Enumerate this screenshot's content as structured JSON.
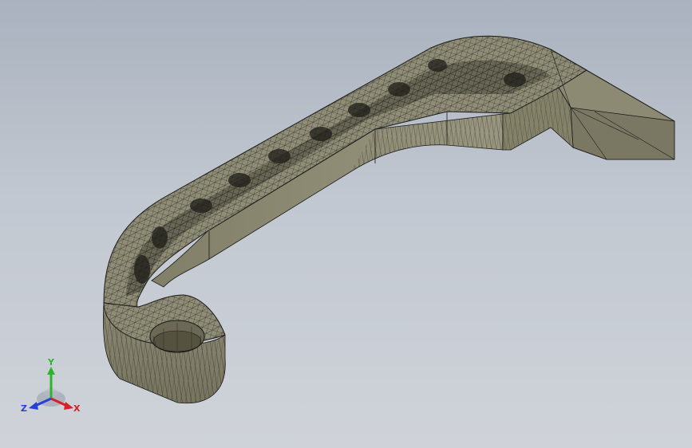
{
  "viewport": {
    "background_top": "#a9b2be",
    "background_bottom": "#cfd3d9"
  },
  "model": {
    "shape": "hook-bracket",
    "render_mode": "shaded-with-tessellation-edges",
    "face_color": "#8f8d76",
    "face_dark": "#6e6c59",
    "face_light": "#a09e88",
    "edge_color": "#1a1a1a"
  },
  "triad": {
    "x_label": "X",
    "y_label": "Y",
    "z_label": "Z",
    "x_color": "#d81f26",
    "y_color": "#2db32d",
    "z_color": "#2642d6"
  }
}
